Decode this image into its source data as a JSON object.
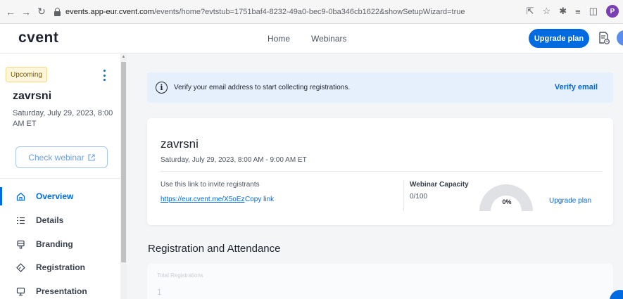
{
  "browser": {
    "url_host": "events.app-eur.cvent.com",
    "url_rest": "/events/home?evtstub=1751baf4-8232-49a0-bec9-0ba346cb1622&showSetupWizard=true",
    "profile_initial": "P"
  },
  "header": {
    "logo": "cvent",
    "nav": [
      "Home",
      "Webinars"
    ],
    "upgrade_label": "Upgrade plan"
  },
  "sidebar": {
    "status": "Upcoming",
    "event_name": "zavrsni",
    "event_date": "Saturday, July 29, 2023, 8:00 AM ET",
    "check_webinar_label": "Check webinar",
    "items": [
      {
        "label": "Overview",
        "icon": "home-icon",
        "active": true
      },
      {
        "label": "Details",
        "icon": "list-icon",
        "active": false
      },
      {
        "label": "Branding",
        "icon": "palette-icon",
        "active": false
      },
      {
        "label": "Registration",
        "icon": "tag-icon",
        "active": false
      },
      {
        "label": "Presentation",
        "icon": "monitor-icon",
        "active": false
      }
    ]
  },
  "alert": {
    "message": "Verify your email address to start collecting registrations.",
    "action": "Verify email"
  },
  "event_card": {
    "title": "zavrsni",
    "datetime": "Saturday, July 29, 2023, 8:00 AM - 9:00 AM ET",
    "invite_label": "Use this link to invite registrants",
    "invite_url": "https://eur.cvent.me/X5oEz",
    "copy_label": "Copy link",
    "capacity_label": "Webinar Capacity",
    "capacity_value": "0/100",
    "capacity_percent_text": "0%",
    "capacity_fraction": 0,
    "upgrade_label": "Upgrade plan"
  },
  "registration": {
    "section_title": "Registration and Attendance",
    "total_label": "Total Registrations",
    "total_value": "1"
  },
  "colors": {
    "accent": "#006ae1",
    "badge_bg": "#fff6dc",
    "alert_bg": "#e6f0fd",
    "gauge_track": "#dfe1e5"
  }
}
